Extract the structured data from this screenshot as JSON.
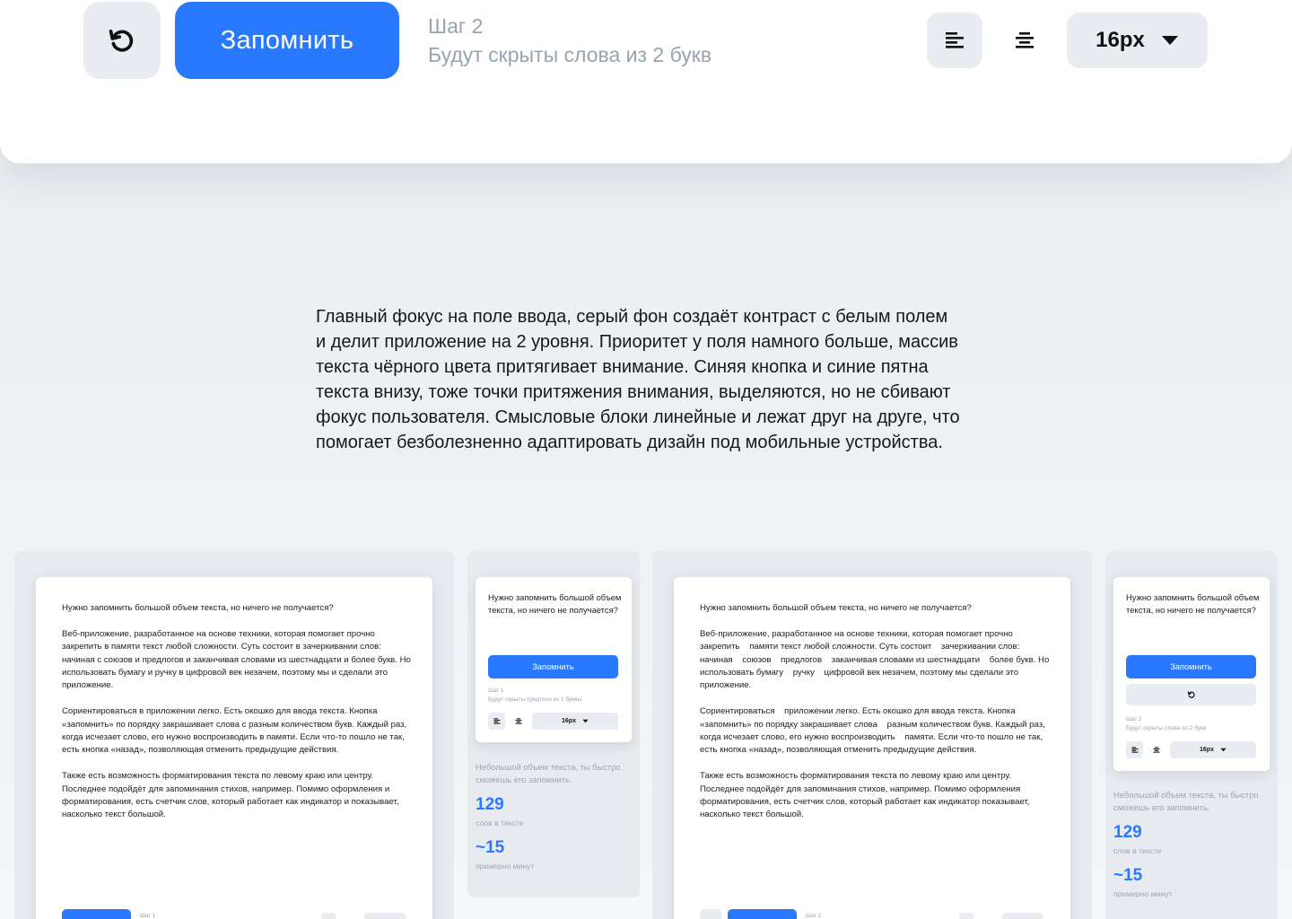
{
  "toolbar": {
    "remember_label": "Запомнить",
    "step_label": "Шаг 2",
    "step_description": "Будут скрыты слова из 2 букв",
    "font_size": "16px",
    "icons": [
      "undo-icon",
      "align-left-icon",
      "align-center-icon",
      "caret-down-icon"
    ]
  },
  "description": "Главный фокус на поле ввода, серый фон создаёт контраст с белым полем и делит приложение на 2 уровня. Приоритет у поля намного больше, массив текста чёрного цвета притягивает внимание. Синяя кнопка и синие пятна текста внизу, тоже точки притяжения внимания, выделяются, но не сбивают фокус пользователя. Смысловые блоки линейные и лежат друг на друге, что помогает безболезненно адаптировать дизайн под мобильные устройства.",
  "preview1": {
    "p1": "Нужно запомнить большой объем текста, но ничего не получается?",
    "p2": "Веб-приложение, разработанное на основе техники, которая помогает прочно закрепить в памяти текст любой сложности. Суть состоит в зачеркивании слов: начиная с союзов и предлогов и заканчивая словами из шестнадцати и более букв. Но использовать бумагу и ручку в цифровой век незачем, поэтому мы и сделали это приложение.",
    "p3": "Сориентироваться в приложении легко. Есть окошко для ввода текста. Кнопка «запомнить» по порядку закрашивает слова с разным количеством букв. Каждый раз, когда исчезает слово, его нужно воспроизводить в памяти. Если что-то пошло не так, есть кнопка «назад», позволяющая отменить предыдущие действия.",
    "p4": "Также есть возможность форматирования текста по левому краю или центру. Последнее подойдёт для запоминания стихов, например. Помимо оформления и форматирования, есть счетчик слов, который работает как индикатор и показывает, насколько текст большой.",
    "step": "Шаг 1"
  },
  "mobile1": {
    "question": "Нужно запомнить большой объем текста, но ничего не получается?",
    "button": "Запомнить",
    "step": "Шаг 1",
    "step_desc": "Будут скрыты предлоги из 1 буквы",
    "size": "16px",
    "info": "Небольшой объем текста, ты быстро сможешь его запомнить.",
    "words": "129",
    "words_label": "слов в тексте",
    "minutes": "~15",
    "minutes_label": "примерно минут"
  },
  "preview2": {
    "p1": "Нужно запомнить большой объем текста, но ничего не получается?",
    "p2": "Веб-приложение, разработанное на основе техники, которая помогает прочно закрепить &nbsp;&nbsp; памяти текст любой сложности. Суть состоит &nbsp;&nbsp; зачеркивании слов: начиная &nbsp;&nbsp; союзов &nbsp;&nbsp; предлогов &nbsp;&nbsp; заканчивая словами из шестнадцати &nbsp;&nbsp; более букв. Но использовать бумагу &nbsp;&nbsp; ручку &nbsp;&nbsp; цифровой век незачем, поэтому мы сделали это приложение.",
    "p3": "Сориентироваться &nbsp;&nbsp; приложении легко. Есть окошко для ввода текста. Кнопка «запомнить» по порядку закрашивает слова &nbsp;&nbsp; разным количеством букв. Каждый раз, когда исчезает слово, его нужно воспроизводить &nbsp;&nbsp; памяти. Если что-то пошло не так, есть кнопка «назад», позволяющая отменить предыдущие действия.",
    "p4": "Также есть возможность форматирования текста по левому краю или центру. Последнее подойдёт для запоминания стихов, например. Помимо оформления &nbsp;&nbsp; форматирования, есть счетчик слов, который работает как индикатор показывает, насколько текст большой.",
    "step": "Шаг 2"
  },
  "mobile2": {
    "question": "Нужно запомнить большой объем текста, но ничего не получается?",
    "button": "Запомнить",
    "step": "Шаг 2",
    "step_desc": "Будут скрыты слова из 2 букв",
    "size": "16px",
    "info": "Небольшой объем текста, ты быстро сможешь его запомнить.",
    "words": "129",
    "words_label": "слов в тексте",
    "minutes": "~15",
    "minutes_label": "примерно минут"
  }
}
